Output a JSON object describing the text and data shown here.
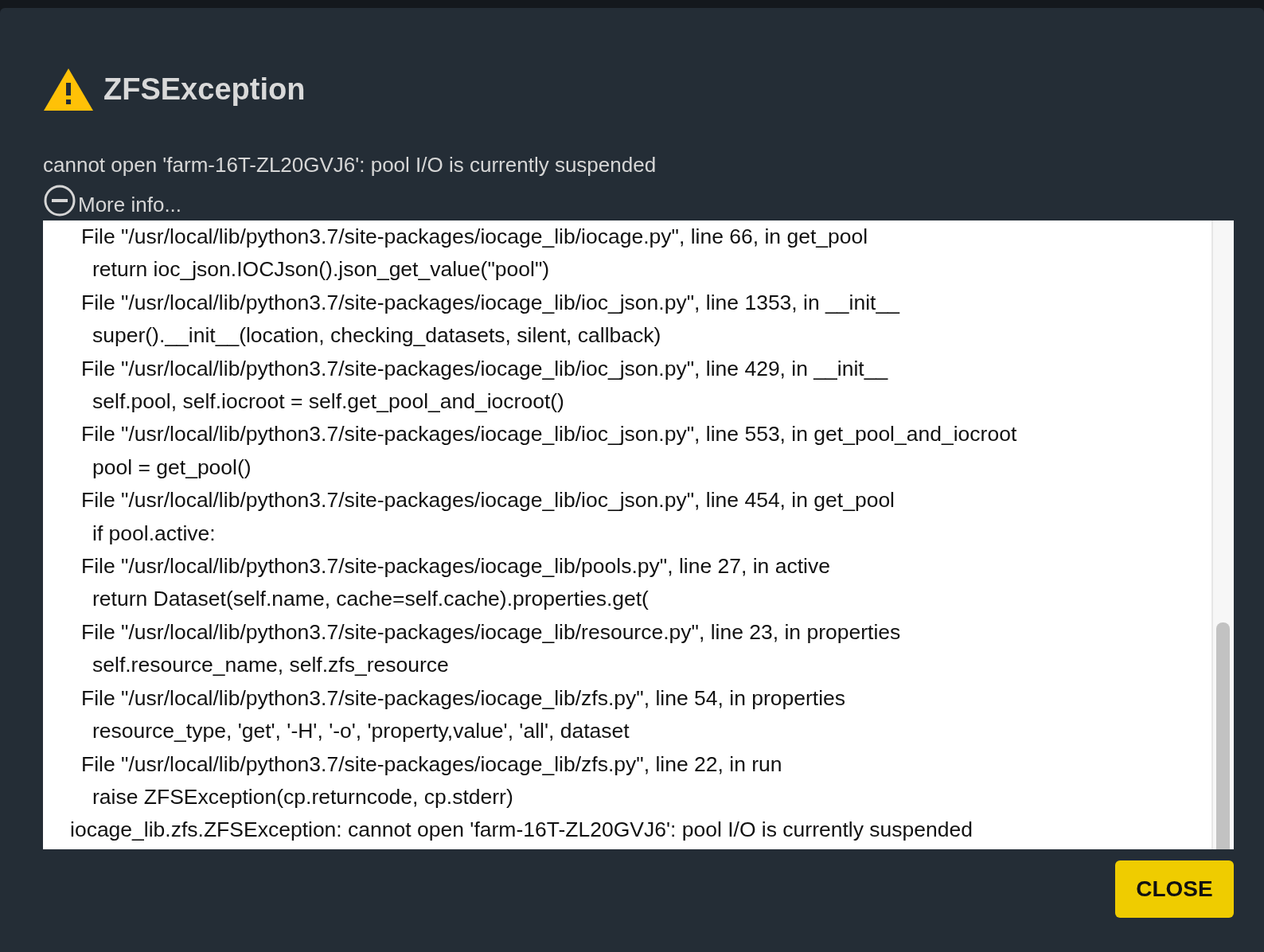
{
  "dialog": {
    "title": "ZFSException",
    "message": "cannot open 'farm-16T-ZL20GVJ6': pool I/O is currently suspended",
    "more_info": {
      "label": "More info...",
      "expanded": true
    },
    "trace": [
      {
        "kind": "file",
        "text": "File \"/usr/local/lib/python3.7/site-packages/iocage_lib/iocage.py\", line 66, in get_pool"
      },
      {
        "kind": "code",
        "text": "return ioc_json.IOCJson().json_get_value(\"pool\")"
      },
      {
        "kind": "file",
        "text": "File \"/usr/local/lib/python3.7/site-packages/iocage_lib/ioc_json.py\", line 1353, in __init__"
      },
      {
        "kind": "code",
        "text": "super().__init__(location, checking_datasets, silent, callback)"
      },
      {
        "kind": "file",
        "text": "File \"/usr/local/lib/python3.7/site-packages/iocage_lib/ioc_json.py\", line 429, in __init__"
      },
      {
        "kind": "code",
        "text": "self.pool, self.iocroot = self.get_pool_and_iocroot()"
      },
      {
        "kind": "file",
        "text": "File \"/usr/local/lib/python3.7/site-packages/iocage_lib/ioc_json.py\", line 553, in get_pool_and_iocroot"
      },
      {
        "kind": "code",
        "text": "pool = get_pool()"
      },
      {
        "kind": "file",
        "text": "File \"/usr/local/lib/python3.7/site-packages/iocage_lib/ioc_json.py\", line 454, in get_pool"
      },
      {
        "kind": "code",
        "text": "if pool.active:"
      },
      {
        "kind": "file",
        "text": "File \"/usr/local/lib/python3.7/site-packages/iocage_lib/pools.py\", line 27, in active"
      },
      {
        "kind": "code",
        "text": "return Dataset(self.name, cache=self.cache).properties.get("
      },
      {
        "kind": "file",
        "text": "File \"/usr/local/lib/python3.7/site-packages/iocage_lib/resource.py\", line 23, in properties"
      },
      {
        "kind": "code",
        "text": "self.resource_name, self.zfs_resource"
      },
      {
        "kind": "file",
        "text": "File \"/usr/local/lib/python3.7/site-packages/iocage_lib/zfs.py\", line 54, in properties"
      },
      {
        "kind": "code",
        "text": "resource_type, 'get', '-H', '-o', 'property,value', 'all', dataset"
      },
      {
        "kind": "file",
        "text": "File \"/usr/local/lib/python3.7/site-packages/iocage_lib/zfs.py\", line 22, in run"
      },
      {
        "kind": "code",
        "text": "raise ZFSException(cp.returncode, cp.stderr)"
      },
      {
        "kind": "error",
        "text": "iocage_lib.zfs.ZFSException: cannot open 'farm-16T-ZL20GVJ6': pool I/O is currently suspended"
      }
    ],
    "buttons": [
      {
        "label": "CLOSE"
      }
    ]
  }
}
